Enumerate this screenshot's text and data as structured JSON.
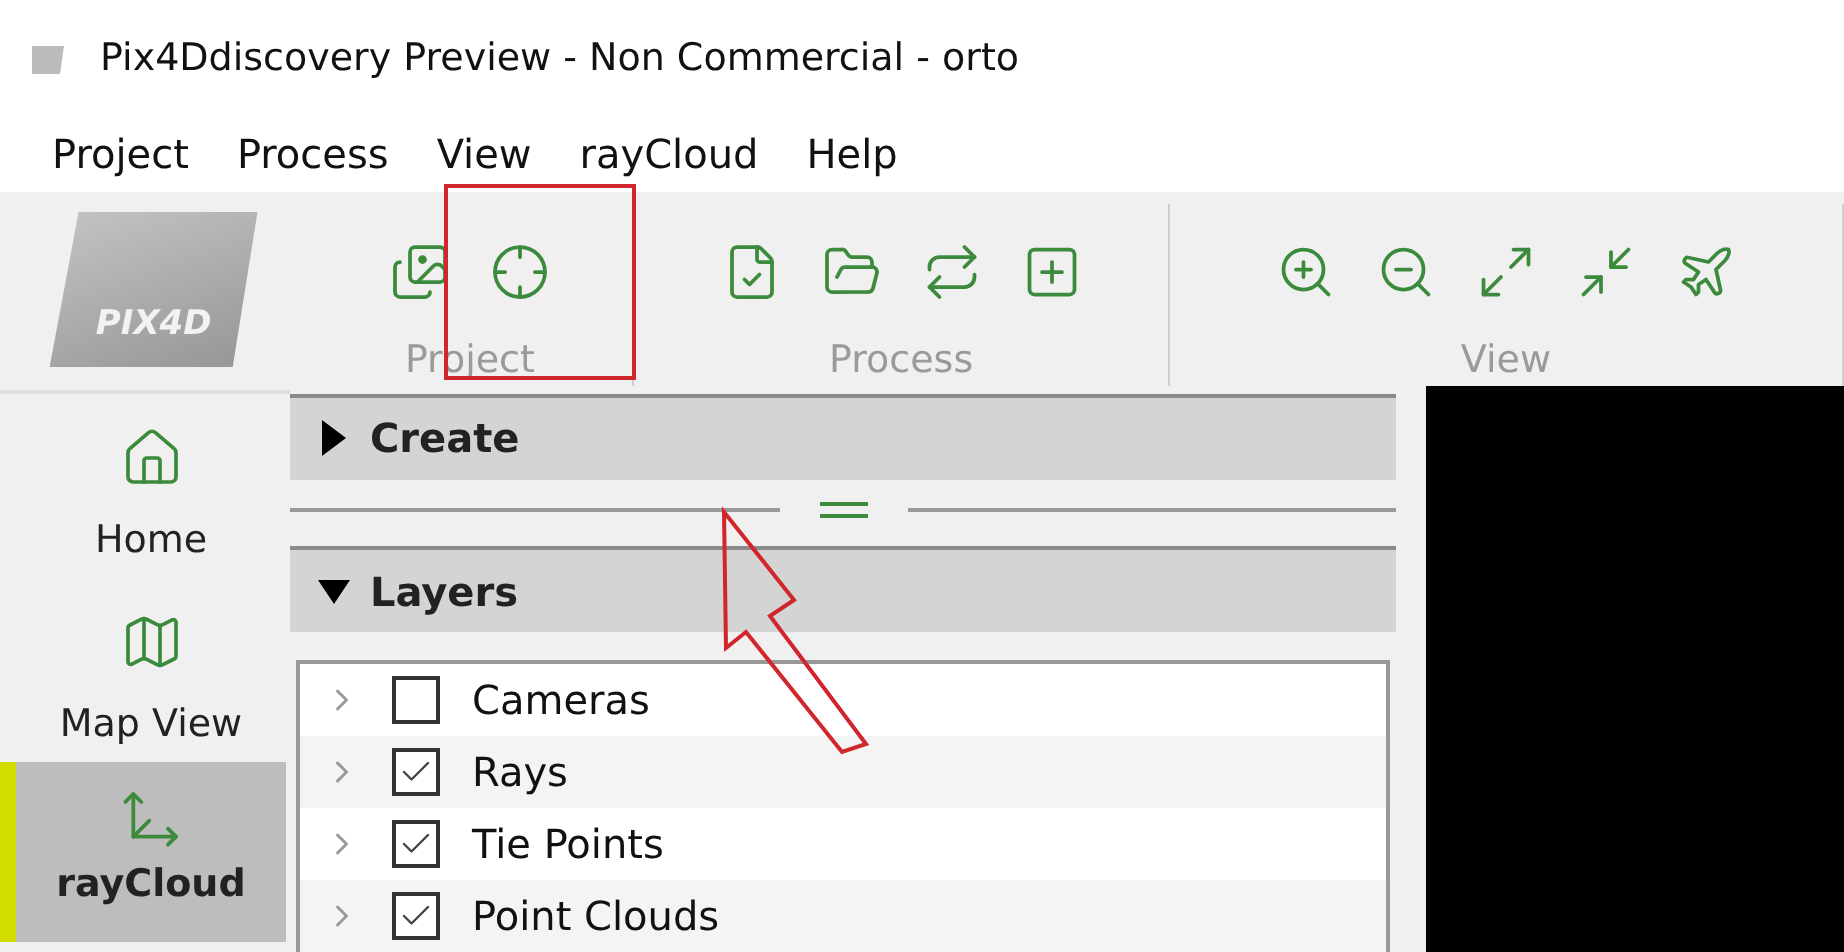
{
  "window": {
    "title": "Pix4Ddiscovery Preview - Non Commercial - orto"
  },
  "logo": "PIX4D",
  "menu": [
    "Project",
    "Process",
    "View",
    "rayCloud",
    "Help"
  ],
  "toolbar": {
    "groups": [
      {
        "label": "Project"
      },
      {
        "label": "Process"
      },
      {
        "label": "View"
      }
    ]
  },
  "sidebar": {
    "items": [
      {
        "label": "Home",
        "selected": false
      },
      {
        "label": "Map View",
        "selected": false
      },
      {
        "label": "rayCloud",
        "selected": true
      }
    ]
  },
  "sections": [
    {
      "title": "Create",
      "expanded": false
    },
    {
      "title": "Layers",
      "expanded": true
    }
  ],
  "layers": [
    {
      "label": "Cameras",
      "checked": false
    },
    {
      "label": "Rays",
      "checked": true
    },
    {
      "label": "Tie Points",
      "checked": true
    },
    {
      "label": "Point Clouds",
      "checked": true
    }
  ]
}
